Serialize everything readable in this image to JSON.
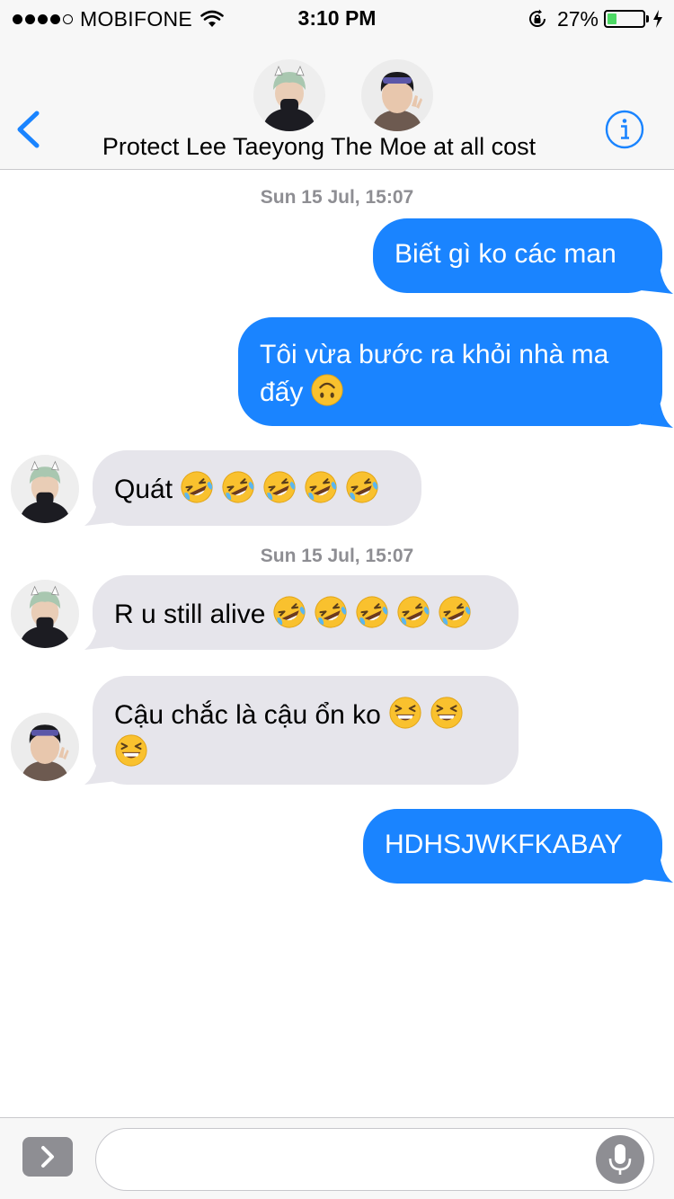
{
  "status_bar": {
    "carrier": "MOBIFONE",
    "time": "3:10 PM",
    "battery_percent_label": "27%",
    "battery_level": 0.27,
    "signal_bars": 4,
    "signal_max": 5
  },
  "nav": {
    "back_icon": "chevron-left-icon",
    "info_icon": "info-icon",
    "title": "Protect Lee Taeyong The Moe at all cost",
    "accent_color": "#1a84ff"
  },
  "messages": [
    {
      "type": "timestamp",
      "text": "Sun 15 Jul, 15:07"
    },
    {
      "type": "outgoing",
      "text": "Biết gì ko các man"
    },
    {
      "type": "outgoing",
      "text": "Tôi vừa bước ra khỏi nhà ma đấy",
      "emoji": [
        "upside-down-face"
      ]
    },
    {
      "type": "incoming",
      "text": "Quát",
      "emoji": [
        "rolling-on-floor-laughing",
        "rolling-on-floor-laughing",
        "rolling-on-floor-laughing",
        "rolling-on-floor-laughing",
        "rolling-on-floor-laughing"
      ]
    },
    {
      "type": "timestamp",
      "text": "Sun 15 Jul, 15:07"
    },
    {
      "type": "incoming",
      "text": "R u still alive",
      "emoji": [
        "rolling-on-floor-laughing",
        "rolling-on-floor-laughing",
        "rolling-on-floor-laughing",
        "rolling-on-floor-laughing",
        "rolling-on-floor-laughing"
      ]
    },
    {
      "type": "incoming",
      "text": "Cậu chắc là cậu ổn ko",
      "emoji": [
        "grinning-squinting-face",
        "grinning-squinting-face",
        "grinning-squinting-face"
      ]
    },
    {
      "type": "outgoing",
      "text": "HDHSJWKFKABAY"
    }
  ],
  "input_bar": {
    "expand_icon": "chevron-right-icon",
    "mic_icon": "microphone-icon",
    "placeholder": ""
  },
  "colors": {
    "outgoing_bubble": "#1a84ff",
    "incoming_bubble": "#e6e5eb",
    "timestamp": "#8e8e93",
    "battery_fill": "#4cd964"
  }
}
